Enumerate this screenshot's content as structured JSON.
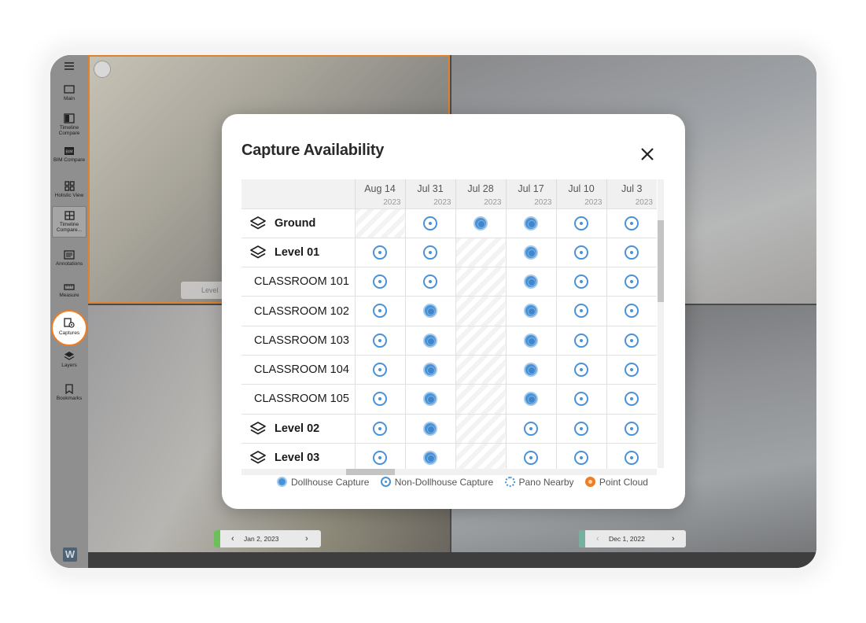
{
  "sidebar": {
    "items": [
      {
        "label": "Main",
        "icon": "monitor-icon"
      },
      {
        "label": "Timeline Compare",
        "icon": "timeline-compare-icon"
      },
      {
        "label": "BIM Compare",
        "icon": "bim-icon"
      },
      {
        "label": "Holistic View",
        "icon": "grid-icon"
      },
      {
        "label": "Timeline Compare...",
        "icon": "quad-view-icon"
      },
      {
        "label": "Annotations",
        "icon": "annotations-icon"
      },
      {
        "label": "Measure",
        "icon": "ruler-icon"
      },
      {
        "label": "Captures",
        "icon": "captures-icon"
      },
      {
        "label": "Layers",
        "icon": "layers-icon"
      },
      {
        "label": "Bookmarks",
        "icon": "bookmark-icon"
      }
    ],
    "logo": "W"
  },
  "panes": {
    "level_chip": "Level",
    "date_left": "Jan 2, 2023",
    "date_right": "Dec 1, 2022"
  },
  "modal": {
    "title": "Capture Availability",
    "columns": [
      {
        "date": "Aug 14",
        "year": "2023"
      },
      {
        "date": "Jul 31",
        "year": "2023"
      },
      {
        "date": "Jul 28",
        "year": "2023"
      },
      {
        "date": "Jul 17",
        "year": "2023"
      },
      {
        "date": "Jul 10",
        "year": "2023"
      },
      {
        "date": "Jul 3",
        "year": "2023"
      }
    ],
    "rows": [
      {
        "name": "Ground",
        "type": "level",
        "cells": [
          "none",
          "ndh",
          "dh",
          "dh",
          "ndh",
          "ndh"
        ]
      },
      {
        "name": "Level 01",
        "type": "level",
        "cells": [
          "ndh",
          "ndh",
          "none",
          "dh",
          "ndh",
          "ndh"
        ]
      },
      {
        "name": "CLASSROOM 101",
        "type": "room",
        "cells": [
          "ndh",
          "ndh",
          "none",
          "dh",
          "ndh",
          "ndh"
        ]
      },
      {
        "name": "CLASSROOM 102",
        "type": "room",
        "cells": [
          "ndh",
          "dh",
          "none",
          "dh",
          "ndh",
          "ndh"
        ]
      },
      {
        "name": "CLASSROOM 103",
        "type": "room",
        "cells": [
          "ndh",
          "dh",
          "none",
          "dh",
          "ndh",
          "ndh"
        ]
      },
      {
        "name": "CLASSROOM 104",
        "type": "room",
        "cells": [
          "ndh",
          "dh",
          "none",
          "dh",
          "ndh",
          "ndh"
        ]
      },
      {
        "name": "CLASSROOM 105",
        "type": "room",
        "cells": [
          "ndh",
          "dh",
          "none",
          "dh",
          "ndh",
          "ndh"
        ]
      },
      {
        "name": "Level 02",
        "type": "level",
        "cells": [
          "ndh",
          "dh",
          "none",
          "ndh",
          "ndh",
          "ndh"
        ]
      },
      {
        "name": "Level 03",
        "type": "level",
        "cells": [
          "ndh",
          "dh",
          "none",
          "ndh",
          "ndh",
          "ndh"
        ]
      }
    ],
    "legend": {
      "dollhouse": "Dollhouse Capture",
      "non_dollhouse": "Non-Dollhouse Capture",
      "pano_nearby": "Pano Nearby",
      "point_cloud": "Point Cloud"
    }
  },
  "colors": {
    "accent_orange": "#f07d22",
    "capture_blue": "#4a92d6",
    "sidebar_bg": "#8f8f8f"
  }
}
